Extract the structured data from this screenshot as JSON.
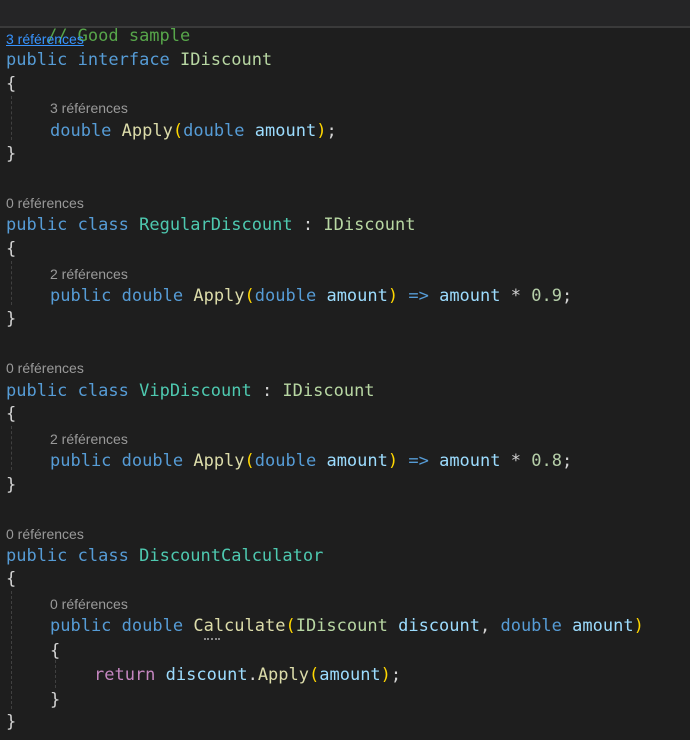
{
  "comment": "// Good sample",
  "refs": {
    "three": "3 références",
    "two": "2 références",
    "zero": "0 références"
  },
  "kw": {
    "public": "public",
    "interface": "interface",
    "class": "class",
    "double": "double",
    "return": "return"
  },
  "names": {
    "idiscount": "IDiscount",
    "regular": "RegularDiscount",
    "vip": "VipDiscount",
    "calculator": "DiscountCalculator",
    "apply": "Apply",
    "calculate": "Calculate",
    "amount": "amount",
    "discount": "discount"
  },
  "punct": {
    "open_brace": "{",
    "close_brace": "}",
    "open_paren": "(",
    "close_paren": ")",
    "semicolon": ";",
    "colon": " : ",
    "arrow": " => ",
    "times": " * ",
    "comma": ", ",
    "dot": "."
  },
  "numbers": {
    "regular_rate": "0.9",
    "vip_rate": "0.8"
  },
  "colors": {
    "background": "#1e1e1e",
    "keyword": "#569cd6",
    "control_keyword": "#c586c0",
    "class_name": "#4ec9b0",
    "interface_name": "#b8d7a3",
    "method": "#dcdcaa",
    "parameter": "#9cdcfe",
    "number": "#b5cea8",
    "comment": "#57a64a",
    "codelens": "#9a9a9a",
    "link": "#3794ff"
  }
}
